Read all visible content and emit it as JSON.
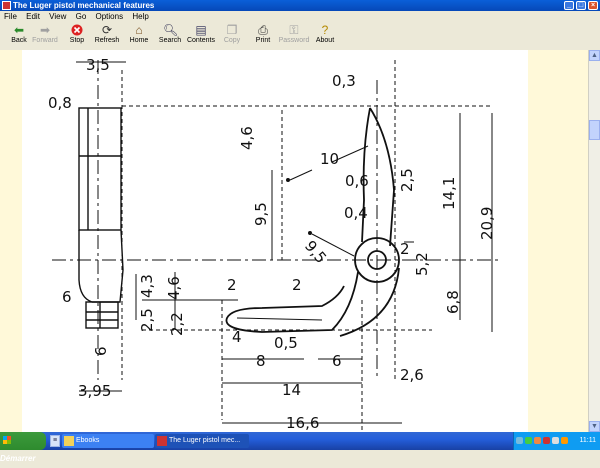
{
  "window": {
    "title": "The Luger pistol mechanical features",
    "buttons": {
      "minimize": "_",
      "maximize": "□",
      "close": "×"
    }
  },
  "menu": [
    "File",
    "Edit",
    "View",
    "Go",
    "Options",
    "Help"
  ],
  "toolbar": [
    {
      "label": "Back",
      "icon": "back-arrow-icon",
      "enabled": true
    },
    {
      "label": "Forward",
      "icon": "forward-arrow-icon",
      "enabled": false
    },
    {
      "label": "Stop",
      "icon": "stop-icon",
      "enabled": true
    },
    {
      "label": "Refresh",
      "icon": "refresh-icon",
      "enabled": true
    },
    {
      "label": "Home",
      "icon": "home-icon",
      "enabled": true
    },
    {
      "label": "Search",
      "icon": "search-icon",
      "enabled": true
    },
    {
      "label": "Contents",
      "icon": "contents-icon",
      "enabled": true
    },
    {
      "label": "Copy",
      "icon": "copy-icon",
      "enabled": false
    },
    {
      "label": "Print",
      "icon": "print-icon",
      "enabled": true
    },
    {
      "label": "Password",
      "icon": "key-icon",
      "enabled": false
    },
    {
      "label": "About",
      "icon": "about-icon",
      "enabled": true
    }
  ],
  "drawing": {
    "dims": [
      "3,5",
      "0,8",
      "0,3",
      "4,6",
      "10",
      "9,5",
      "0,6",
      "0,4",
      "2,5",
      "2",
      "14,1",
      "20,9",
      "9,5",
      "4,3",
      "4,6",
      "6",
      "2,5",
      "2,2",
      "2",
      "2",
      "4",
      "0,5",
      "5,2",
      "6,8",
      "6",
      "8",
      "6",
      "14",
      "2,6",
      "3,95",
      "16,6"
    ]
  },
  "taskbar": {
    "start": "Démarrer",
    "tasks": [
      "Ebooks",
      "The Luger pistol mec..."
    ],
    "clock": "11:11"
  },
  "colors": {
    "title_bar": "#0a5fd8",
    "page_margin": "#fff9d9",
    "taskbar": "#245edb"
  }
}
